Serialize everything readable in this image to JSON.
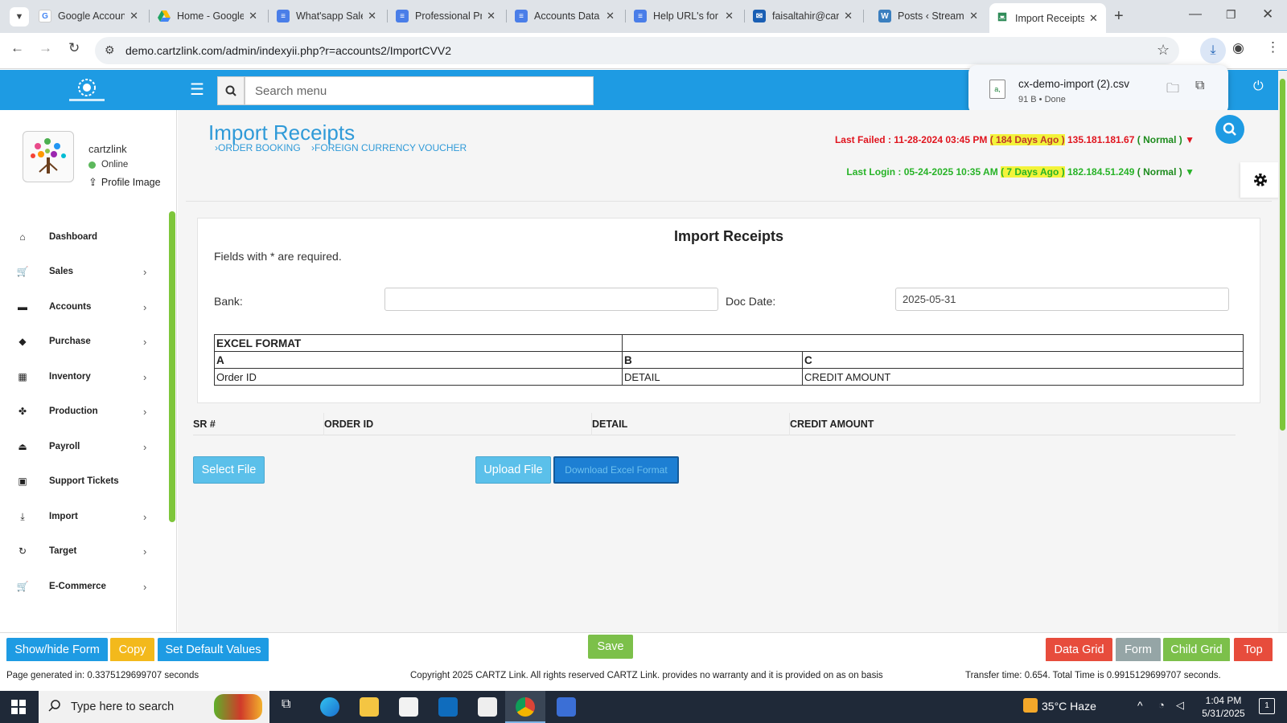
{
  "browser": {
    "tabs": [
      {
        "title": "Google Account",
        "favicon": "google-icon",
        "color": "#4285f4"
      },
      {
        "title": "Home - Google Drive",
        "favicon": "drive-icon",
        "color": "#1fa463"
      },
      {
        "title": "What'sapp Sales",
        "favicon": "docs-icon",
        "color": "#4a7ee8"
      },
      {
        "title": "Professional Profile",
        "favicon": "docs-icon",
        "color": "#4a7ee8"
      },
      {
        "title": "Accounts Data",
        "favicon": "docs-icon",
        "color": "#4a7ee8"
      },
      {
        "title": "Help URL's for",
        "favicon": "docs-icon",
        "color": "#4a7ee8"
      },
      {
        "title": "faisaltahir@cartzlink",
        "favicon": "mail-icon",
        "color": "#1a5fb4"
      },
      {
        "title": "Posts ‹ Streamline",
        "favicon": "wordpress-icon",
        "color": "#3b7fbf"
      },
      {
        "title": "Import Receipts",
        "favicon": "cartzlink-icon",
        "color": "#2e8b57"
      }
    ],
    "url": "demo.cartzlink.com/admin/indexyii.php?r=accounts2/ImportCVV2"
  },
  "download": {
    "filename": "cx-demo-import (2).csv",
    "status": "91 B • Done"
  },
  "header": {
    "search_placeholder": "Search menu"
  },
  "profile": {
    "name": "cartzlink",
    "status": "Online",
    "upload_label": "Profile Image"
  },
  "sidebar": {
    "items": [
      {
        "label": "Dashboard",
        "icon": "home-icon",
        "has_children": false
      },
      {
        "label": "Sales",
        "icon": "cart-icon",
        "has_children": true
      },
      {
        "label": "Accounts",
        "icon": "briefcase-icon",
        "has_children": true
      },
      {
        "label": "Purchase",
        "icon": "tags-icon",
        "has_children": true
      },
      {
        "label": "Inventory",
        "icon": "grid-icon",
        "has_children": true
      },
      {
        "label": "Production",
        "icon": "production-icon",
        "has_children": true
      },
      {
        "label": "Payroll",
        "icon": "payroll-icon",
        "has_children": true
      },
      {
        "label": "Support Tickets",
        "icon": "ticket-icon",
        "has_children": false
      },
      {
        "label": "Import",
        "icon": "import-icon",
        "has_children": true
      },
      {
        "label": "Target",
        "icon": "refresh-icon",
        "has_children": true
      },
      {
        "label": "E-Commerce",
        "icon": "cart-icon",
        "has_children": true
      }
    ]
  },
  "page": {
    "title": "Import Receipts",
    "breadcrumbs": [
      "›ORDER BOOKING",
      "›FOREIGN CURRENCY VOUCHER"
    ],
    "last_failed": {
      "prefix": "Last Failed : 11-28-2024 03:45 PM",
      "ago": "( 184 Days Ago )",
      "ip": "135.181.181.67",
      "mode": "( Normal )",
      "arrow": "▼"
    },
    "last_login": {
      "prefix": "Last Login : 05-24-2025 10:35 AM",
      "ago": "( 7 Days Ago )",
      "ip": "182.184.51.249",
      "mode": "( Normal )",
      "arrow": "▼"
    }
  },
  "form": {
    "title": "Import Receipts",
    "required_note": "Fields with * are required.",
    "bank_label": "Bank:",
    "bank_value": "",
    "doc_date_label": "Doc Date:",
    "doc_date_value": "2025-05-31",
    "excel_format": {
      "title": "EXCEL FORMAT",
      "columns": [
        "A",
        "B",
        "C"
      ],
      "fields": [
        "Order ID",
        "DETAIL",
        "CREDIT AMOUNT"
      ]
    }
  },
  "grid": {
    "headers": [
      "SR #",
      "ORDER ID",
      "DETAIL",
      "CREDIT AMOUNT"
    ]
  },
  "actions": {
    "select_file": "Select File",
    "upload_file": "Upload File",
    "download_format": "Download Excel Format"
  },
  "footer": {
    "buttons": {
      "show_hide_form": "Show/hide Form",
      "copy": "Copy",
      "set_default": "Set Default Values",
      "save": "Save",
      "data_grid": "Data Grid",
      "form": "Form",
      "child_grid": "Child Grid",
      "top": "Top"
    },
    "page_generated": "Page generated in: 0.3375129699707 seconds",
    "copyright": "Copyright 2025 CARTZ Link. All rights reserved CARTZ Link. provides no warranty and it is provided on as on basis",
    "transfer": "Transfer time: 0.654. Total Time is 0.9915129699707 seconds."
  },
  "taskbar": {
    "search_placeholder": "Type here to search",
    "weather": "35°C  Haze",
    "time": "1:04 PM",
    "date": "5/31/2025",
    "notification_count": "1"
  },
  "colors": {
    "brand_blue": "#1e9be3",
    "accent_green": "#7ec63b",
    "failed_red": "#e0141e",
    "login_green": "#27b327"
  }
}
